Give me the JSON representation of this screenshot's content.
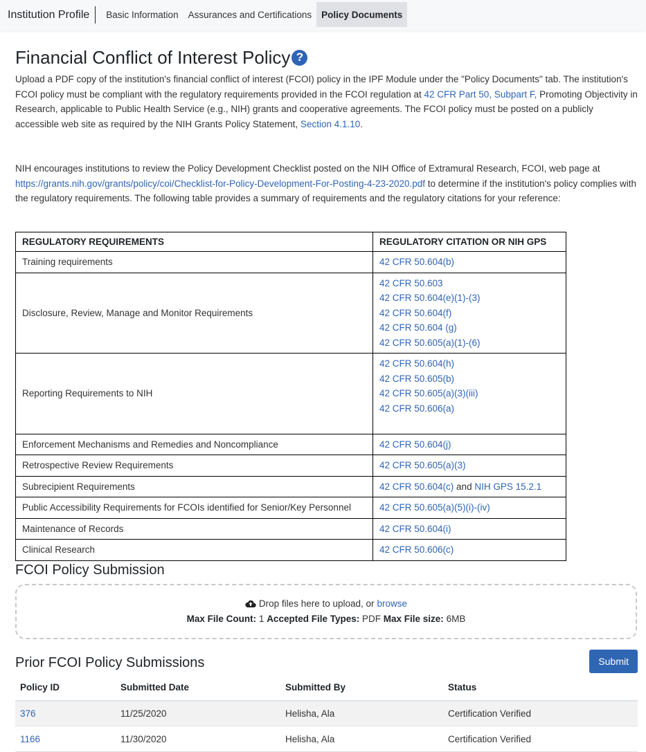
{
  "nav": {
    "brand": "Institution Profile",
    "tabs": [
      {
        "label": "Basic Information",
        "active": false
      },
      {
        "label": "Assurances and Certifications",
        "active": false
      },
      {
        "label": "Policy Documents",
        "active": true
      }
    ]
  },
  "main": {
    "title": "Financial Conflict of Interest Policy",
    "help_icon": "question-circle-icon",
    "intro": {
      "t1": "Upload a PDF copy of the institution's financial conflict of interest (FCOI) policy in the IPF Module under the \"Policy Documents\" tab. The institution's FCOI policy must be compliant with the regulatory requirements provided in the FCOI regulation at ",
      "link1": "42 CFR Part 50, Subpart F,",
      "t2": " Promoting Objectivity in Research, applicable to Public Health Service (e.g., NIH) grants and cooperative agreements. The FCOI policy must be posted on a publicly accessible web site as required by the NIH Grants Policy Statement, ",
      "link2": "Section 4.1.10",
      "t3": "."
    },
    "checklist": {
      "t1": "NIH encourages institutions to review the Policy Development Checklist posted on the NIH Office of Extramural Research, FCOI, web page at ",
      "link": "https://grants.nih.gov/grants/policy/coi/Checklist-for-Policy-Development-For-Posting-4-23-2020.pdf",
      "t2": " to determine if the institution's policy complies with the regulatory requirements. The following table provides a summary of requirements and the regulatory citations for your reference:"
    },
    "reg_table": {
      "headers": [
        "REGULATORY REQUIREMENTS",
        "REGULATORY CITATION OR NIH GPS"
      ],
      "rows": [
        {
          "requirement": "Training requirements",
          "citations": [
            "42 CFR 50.604(b)"
          ]
        },
        {
          "requirement": "Disclosure, Review, Manage and Monitor Requirements",
          "citations": [
            "42 CFR 50.603",
            "42 CFR 50.604(e)(1)-(3)",
            "42 CFR 50.604(f)",
            "42 CFR 50.604 (g)",
            "42 CFR 50.605(a)(1)-(6)"
          ]
        },
        {
          "requirement": "Reporting Requirements to NIH",
          "citations": [
            "42 CFR 50.604(h)",
            "42 CFR 50.605(b)",
            "42 CFR 50.605(a)(3)(iii)",
            "42 CFR 50.606(a)"
          ]
        },
        {
          "requirement": "Enforcement Mechanisms and Remedies and Noncompliance",
          "citations": [
            "42 CFR 50.604(j)"
          ]
        },
        {
          "requirement": "Retrospective Review Requirements",
          "citations": [
            "42 CFR 50.605(a)(3)"
          ]
        },
        {
          "requirement": "Subrecipient Requirements",
          "citation_link1": "42 CFR 50.604(c)",
          "citation_and": " and ",
          "citation_link2": "NIH GPS 15.2.1"
        },
        {
          "requirement": "Public Accessibility Requirements for FCOIs identified for Senior/Key Personnel",
          "citations": [
            "42 CFR 50.605(a)(5)(i)-(iv)"
          ]
        },
        {
          "requirement": "Maintenance of Records",
          "citations": [
            "42 CFR 50.604(i)"
          ]
        },
        {
          "requirement": "Clinical Research",
          "citations": [
            "42 CFR 50.606(c)"
          ]
        }
      ]
    },
    "submission": {
      "title": "FCOI Policy Submission",
      "drop_text": "Drop files here to upload, or ",
      "browse_label": "browse",
      "max_count_label": "Max File Count:",
      "max_count_value": "1",
      "types_label": "Accepted File Types:",
      "types_value": "PDF",
      "size_label": "Max File size:",
      "size_value": "6MB"
    },
    "prior": {
      "title": "Prior FCOI Policy Submissions",
      "submit_label": "Submit",
      "headers": [
        "Policy ID",
        "Submitted Date",
        "Submitted By",
        "Status"
      ],
      "rows": [
        {
          "id": "376",
          "date": "11/25/2020",
          "by": "Helisha, Ala",
          "status": "Certification Verified"
        },
        {
          "id": "1166",
          "date": "11/30/2020",
          "by": "Helisha, Ala",
          "status": "Certification Verified"
        }
      ]
    }
  },
  "colors": {
    "link": "#2f64b5",
    "primary_button": "#2f66b3",
    "nav_bg": "#f7f8fa",
    "active_tab_bg": "#dfe1e5"
  }
}
